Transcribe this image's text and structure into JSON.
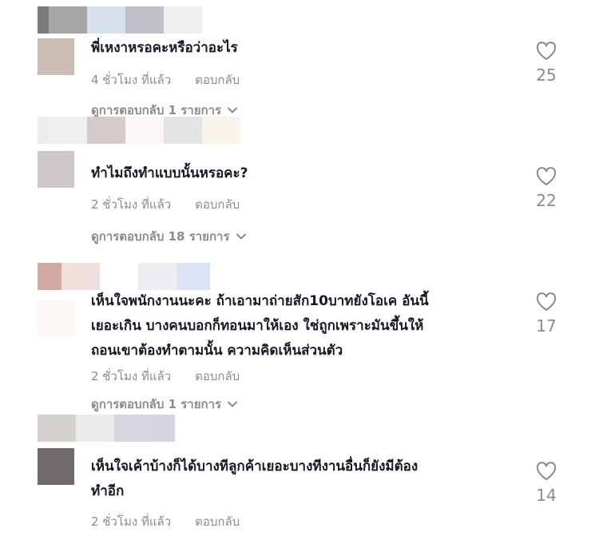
{
  "comments": [
    {
      "text": "พี่เหงาหรอคะหรือว่าอะไร",
      "time": "4 ชั่วโมง ที่แล้ว",
      "reply": "ตอบกลับ",
      "view_replies": "ดูการตอบกลับ 1 รายการ",
      "likes": "25",
      "avatar_color": "#cbbcb4"
    },
    {
      "text": "ทำไมถึงทำแบบนั้นหรอคะ?",
      "time": "2 ชั่วโมง ที่แล้ว",
      "reply": "ตอบกลับ",
      "view_replies": "ดูการตอบกลับ 18 รายการ",
      "likes": "22",
      "avatar_color": "#cfc6cc"
    },
    {
      "text": "เห็นใจพนักงานนะคะ ถ้าเอามาถ่ายสัก10บาทยังโอเค อันนี้\nเยอะเกิน บางคนบอกก็ทอนมาให้เอง ใช่ถูกเพราะมันขึ้นให้\nถอนเขาต้องทำตามนั้น ความคิดเห็นส่วนตัว",
      "time": "2 ชั่วโมง ที่แล้ว",
      "reply": "ตอบกลับ",
      "view_replies": "ดูการตอบกลับ 1 รายการ",
      "likes": "17",
      "avatar_color": "#d6aaa4"
    },
    {
      "text": "เห็นใจเค้าบ้างก็ได้บางทีลูกค้าเยอะบางทีงานอื่นก็ยังมีต้อง\nทำอีก",
      "time": "2 ชั่วโมง ที่แล้ว",
      "reply": "ตอบกลับ",
      "likes": "14",
      "avatar_color": "#726a6a"
    }
  ],
  "colors": {
    "primary_text": "#161823",
    "secondary_text": "#8a8b91",
    "background": "#ffffff"
  },
  "icons": {
    "like": "heart-outline-icon",
    "expand": "chevron-down-icon"
  }
}
